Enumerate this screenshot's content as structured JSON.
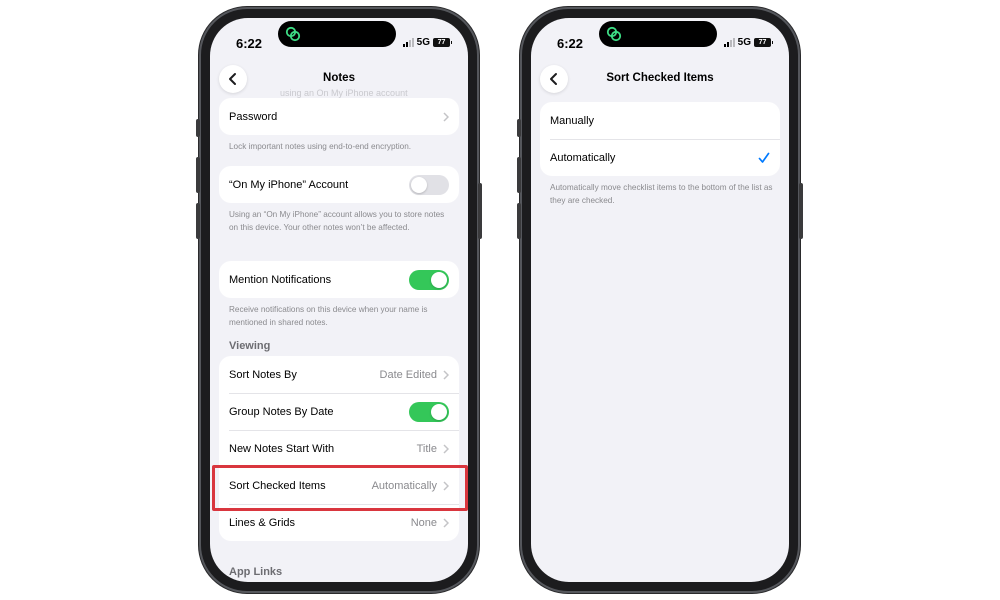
{
  "status_bar": {
    "time": "6:22",
    "network": "5G",
    "battery": "77"
  },
  "left_screen": {
    "nav": {
      "title": "Notes",
      "ghost_text": "using an On My iPhone account"
    },
    "password_row": {
      "label": "Password"
    },
    "password_footer": "Lock important notes using end-to-end encryption.",
    "on_my_iphone_row": {
      "label": "“On My iPhone” Account",
      "toggle": "off"
    },
    "on_my_iphone_footer": "Using an “On My iPhone” account allows you to store notes on this device. Your other notes won’t be affected.",
    "mention_row": {
      "label": "Mention Notifications",
      "toggle": "on"
    },
    "mention_footer": "Receive notifications on this device when your name is mentioned in shared notes.",
    "viewing_header": "Viewing",
    "viewing_rows": [
      {
        "label": "Sort Notes By",
        "value": "Date Edited"
      },
      {
        "label": "Group Notes By Date",
        "toggle": "on"
      },
      {
        "label": "New Notes Start With",
        "value": "Title"
      },
      {
        "label": "Sort Checked Items",
        "value": "Automatically"
      },
      {
        "label": "Lines & Grids",
        "value": "None"
      }
    ],
    "app_links_header": "App Links"
  },
  "right_screen": {
    "nav": {
      "title": "Sort Checked Items"
    },
    "options": [
      {
        "label": "Manually",
        "selected": false
      },
      {
        "label": "Automatically",
        "selected": true
      }
    ],
    "footer": "Automatically move checklist items to the bottom of the list as they are checked."
  },
  "colors": {
    "toggle_on": "#34c759",
    "checkmark": "#007aff",
    "highlight_box": "#d9363e",
    "background": "#f2f2f7"
  },
  "icons": [
    "back-chevron-icon",
    "chevron-right-icon",
    "checkmark-icon",
    "dynamic-island-rings-icon",
    "cellular-signal-icon",
    "battery-icon"
  ]
}
